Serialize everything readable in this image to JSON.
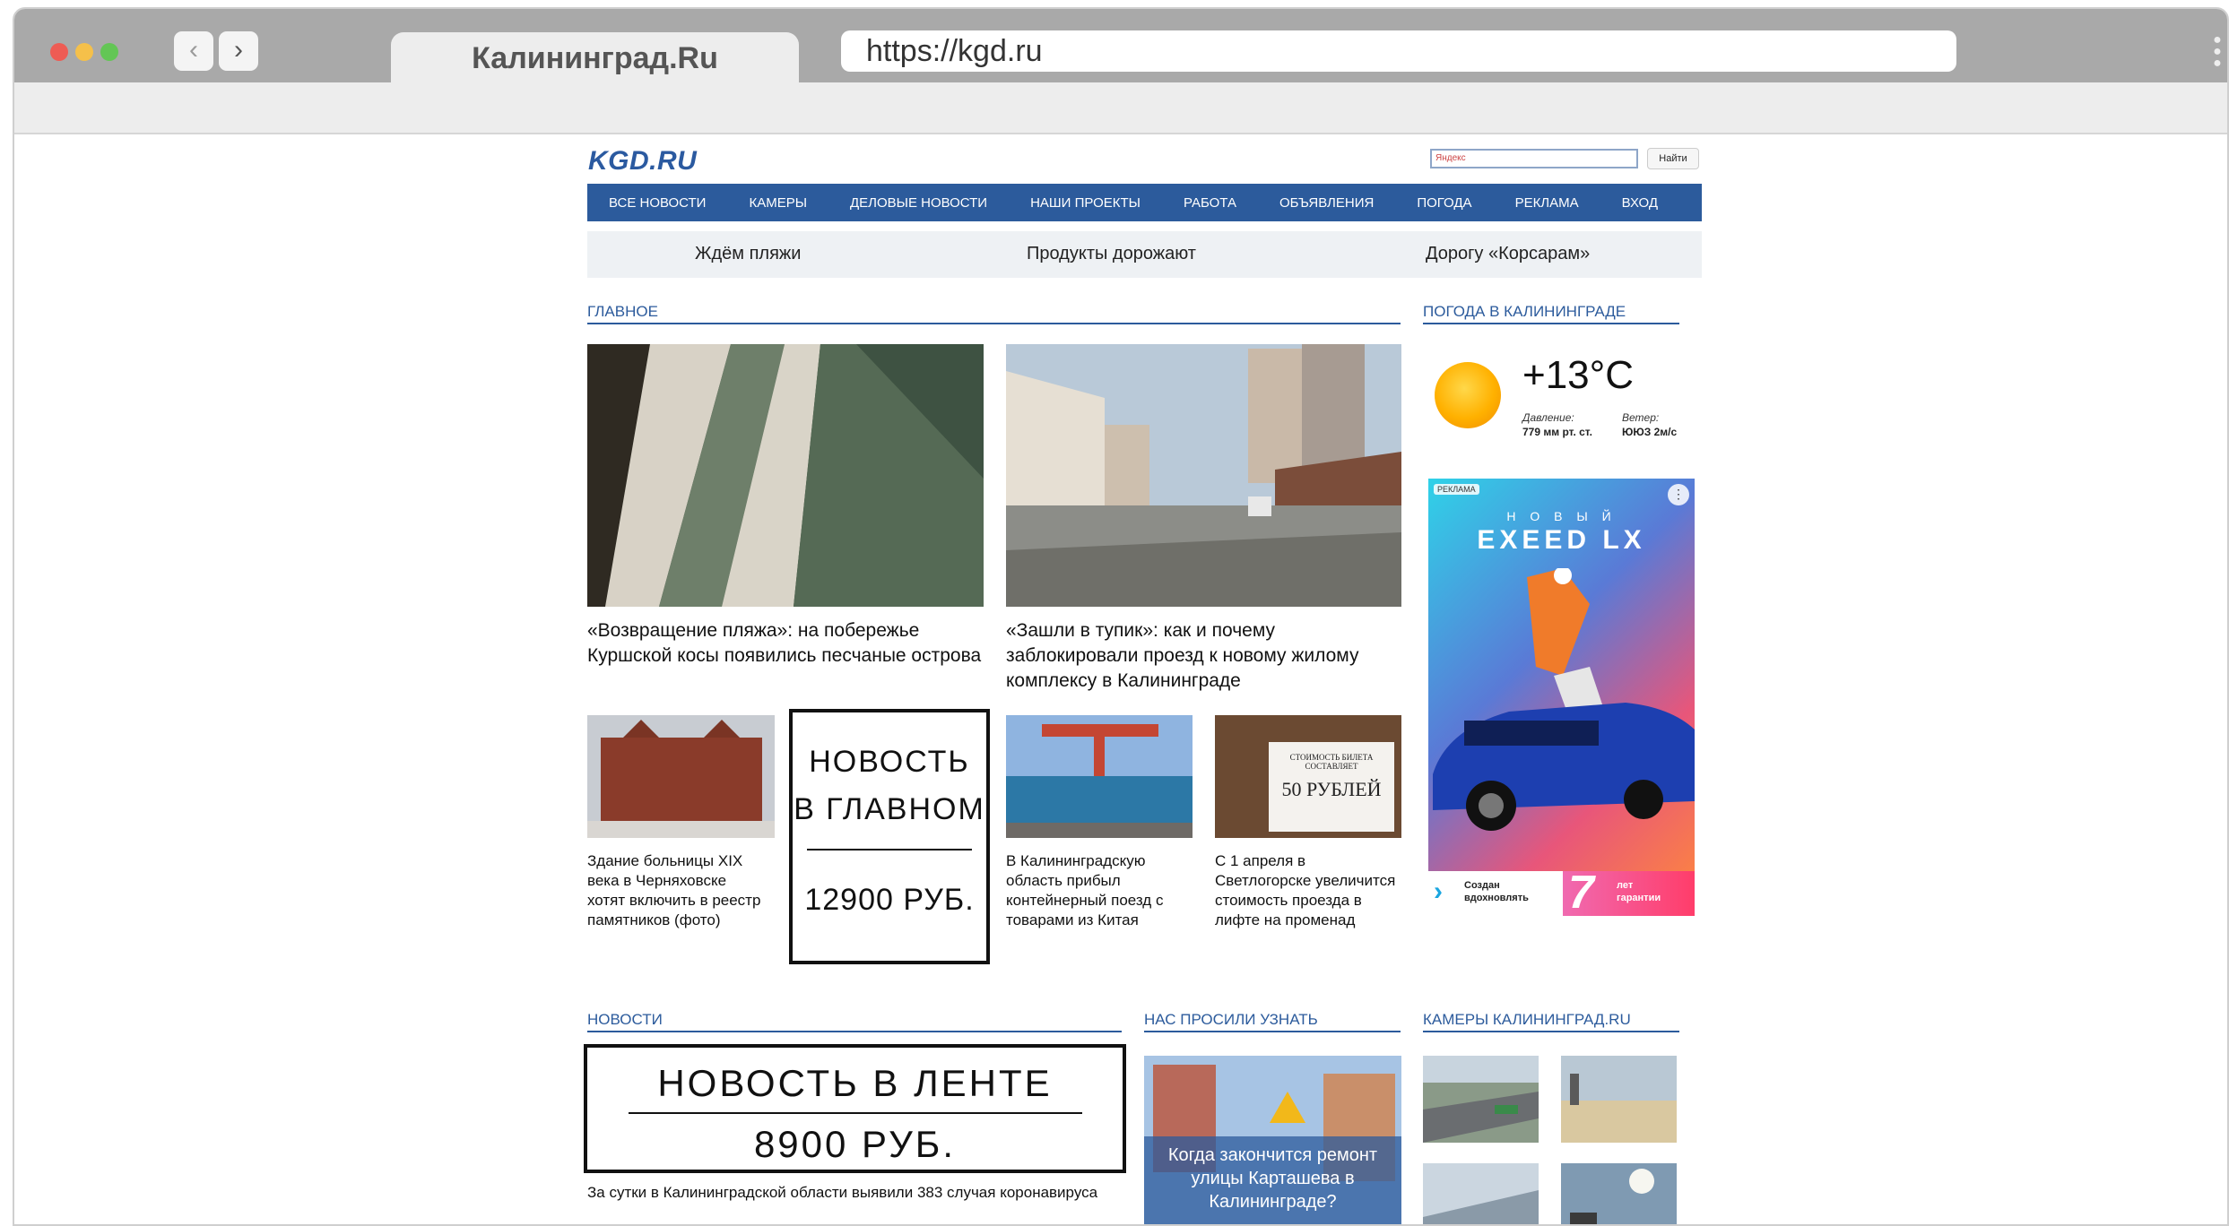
{
  "browser": {
    "tab_title": "Калининград.Ru",
    "url": "https://kgd.ru",
    "back_icon": "‹",
    "forward_icon": "›"
  },
  "site": {
    "logo": "KGD.RU",
    "search_placeholder": "Яндекс",
    "search_button": "Найти"
  },
  "nav": [
    "ВСЕ НОВОСТИ",
    "КАМЕРЫ",
    "ДЕЛОВЫЕ НОВОСТИ",
    "НАШИ ПРОЕКТЫ",
    "РАБОТА",
    "ОБЪЯВЛЕНИЯ",
    "ПОГОДА",
    "РЕКЛАМА",
    "ВХОД"
  ],
  "trends": [
    "Ждём пляжи",
    "Продукты дорожают",
    "Дорогу «Корсарам»"
  ],
  "sections": {
    "main": "ГЛАВНОЕ",
    "weather": "ПОГОДА В КАЛИНИНГРАДЕ",
    "news": "НОВОСТИ",
    "asked": "НАС ПРОСИЛИ УЗНАТЬ",
    "cameras": "КАМЕРЫ КАЛИНИНГРАД.RU"
  },
  "main_news": {
    "big1": "«Возвращение пляжа»: на побережье Куршской косы появились песчаные острова",
    "big2": "«Зашли в тупик»: как и почему заблокировали проезд к новому жилому комплексу в Калининграде",
    "small1": "Здание больницы XIX века в Черняховске хотят включить в реестр памятников (фото)",
    "small2": "В Калининградскую область прибыл контейнерный поезд с товарами из Китая",
    "small3": "С 1 апреля в Светлогорске увеличится стоимость проезда в лифте на променад"
  },
  "promo_main": {
    "line1": "НОВОСТЬ",
    "line2": "В ГЛАВНОМ",
    "price": "12900 РУБ."
  },
  "promo_feed": {
    "line1": "НОВОСТЬ В ЛЕНТЕ",
    "price": "8900 РУБ."
  },
  "sign_photo": {
    "line1": "СТОИМОСТЬ БИЛЕТА",
    "line2": "СОСТАВЛЯЕТ",
    "price": "50 РУБЛЕЙ"
  },
  "weather": {
    "temp": "+13°C",
    "pressure_label": "Давление:",
    "pressure_value": "779 мм рт. ст.",
    "wind_label": "Ветер:",
    "wind_value": "ЮЮЗ 2м/с"
  },
  "banner": {
    "label": "РЕКЛАМА",
    "top": "Н О В Ы Й",
    "brand": "EXEED LX",
    "slogan1": "Создан",
    "slogan2": "вдохновлять",
    "years": "7",
    "guarantee1": "лет",
    "guarantee2": "гарантии"
  },
  "feed": {
    "item1": "За сутки в Калининградской области выявили 383 случая коронавируса"
  },
  "asked": {
    "title": "Когда закончится ремонт улицы Карташева в Калининграде?"
  }
}
